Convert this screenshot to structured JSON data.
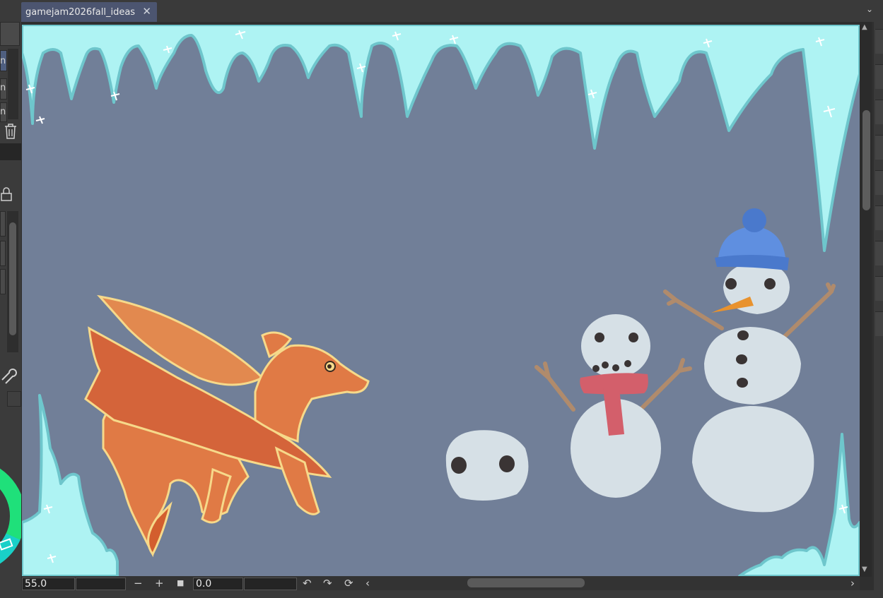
{
  "document": {
    "tab_title": "gamejam2026fall_ideas",
    "close_glyph": "✕",
    "menu_glyph": "⌄"
  },
  "left_panel": {
    "partial_labels": [
      "n",
      "n",
      "n"
    ]
  },
  "navigator": {
    "zoom_value": "55.0",
    "rotation_value": "0.0",
    "zoom_out_glyph": "−",
    "zoom_in_glyph": "+",
    "fit_glyph": "■",
    "rotate_left_glyph": "↶",
    "rotate_right_glyph": "↷",
    "reset_rotation_glyph": "⟳",
    "scroll_left_glyph": "‹",
    "scroll_right_glyph": "›"
  },
  "icons": {
    "delete": "trash-icon",
    "lock": "lock-icon",
    "settings": "wrench-icon",
    "color_wheel": "color-wheel-icon"
  },
  "colors": {
    "canvas_bg": "#717f98",
    "ice": "#aef3f3",
    "ice_outline": "#6ec6cc",
    "dragon": "#e07a45",
    "dragon_wing": "#e2894f",
    "dragon_outline": "#f6d98a",
    "snow": "#d6e0e6",
    "scarf": "#d35f6b",
    "hat": "#5f8fe0",
    "carrot": "#e8922e",
    "stick": "#b08b6c",
    "tab_active": "#4c5570"
  }
}
